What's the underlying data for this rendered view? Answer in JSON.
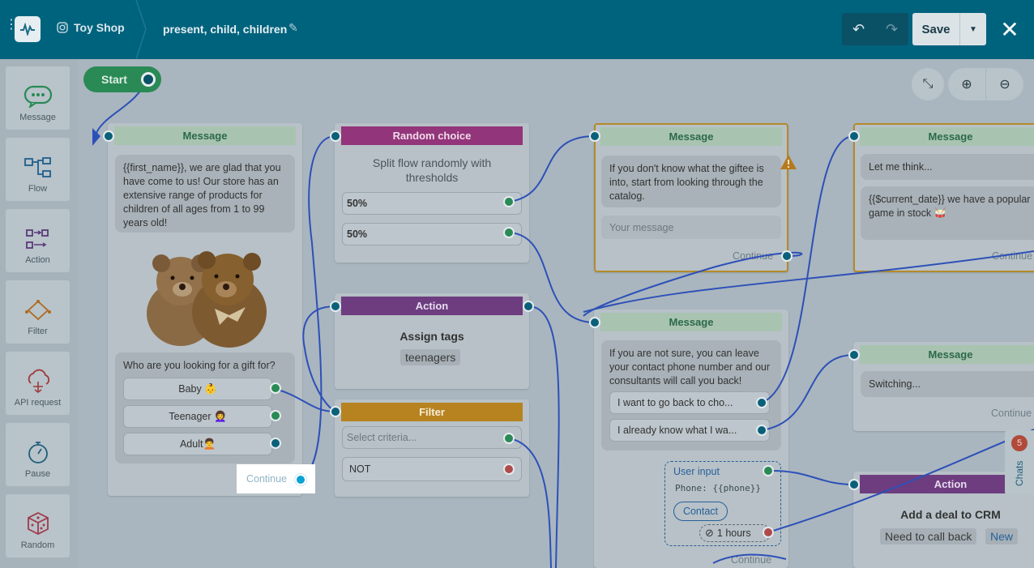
{
  "header": {
    "shop_name": "Toy Shop",
    "flow_name": "present, child, children",
    "save_label": "Save"
  },
  "sidebar": {
    "items": [
      {
        "label": "Message",
        "icon": "message-icon"
      },
      {
        "label": "Flow",
        "icon": "flow-icon"
      },
      {
        "label": "Action",
        "icon": "action-icon"
      },
      {
        "label": "Filter",
        "icon": "filter-icon"
      },
      {
        "label": "API request",
        "icon": "api-request-icon"
      },
      {
        "label": "Pause",
        "icon": "stopwatch-icon"
      },
      {
        "label": "Random",
        "icon": "dice-icon"
      }
    ]
  },
  "canvas": {
    "start_label": "Start",
    "node_message1": {
      "title": "Message",
      "text": "{{first_name}}, we are glad that you have come to us! Our store has an extensive range of products for children of all ages from 1 to 99 years old!",
      "question": "Who are you looking for a gift for?",
      "buttons": [
        "Baby 👶",
        "Teenager 👩‍🦱",
        "Adult🧑‍🦱"
      ],
      "continue": "Continue"
    },
    "node_random": {
      "title": "Random choice",
      "description": "Split flow randomly with thresholds",
      "options": [
        "50%",
        "50%"
      ]
    },
    "node_action1": {
      "title": "Action",
      "heading": "Assign tags",
      "tag": "teenagers"
    },
    "node_filter": {
      "title": "Filter",
      "placeholder": "Select criteria...",
      "not_label": "NOT"
    },
    "node_message2": {
      "title": "Message",
      "text": "If you don't know what the giftee is into, start from looking through the catalog.",
      "placeholder": "Your message",
      "continue": "Continue"
    },
    "node_message3": {
      "title": "Message",
      "text": "If you are not sure, you can leave your contact phone number and our consultants will call you back!",
      "buttons": [
        "I want to go back to cho...",
        "I already know what I wa..."
      ],
      "user_input_label": "User input",
      "phone_label": "Phone: {{phone}}",
      "contact_button": "Contact",
      "timer": "1 hours",
      "continue": "Continue"
    },
    "node_message4": {
      "title": "Message",
      "text1": "Let me think...",
      "text2": "{{$current_date}} we have a popular game in stock 🥁",
      "continue": "Continue"
    },
    "node_message5": {
      "title": "Message",
      "text": "Switching...",
      "continue": "Continue"
    },
    "node_action2": {
      "title": "Action",
      "heading": "Add a deal to CRM",
      "tag": "Need to call back",
      "tag_new": "New"
    },
    "highlight_continue": "Continue"
  },
  "chats": {
    "label": "Chats",
    "count": "5"
  }
}
